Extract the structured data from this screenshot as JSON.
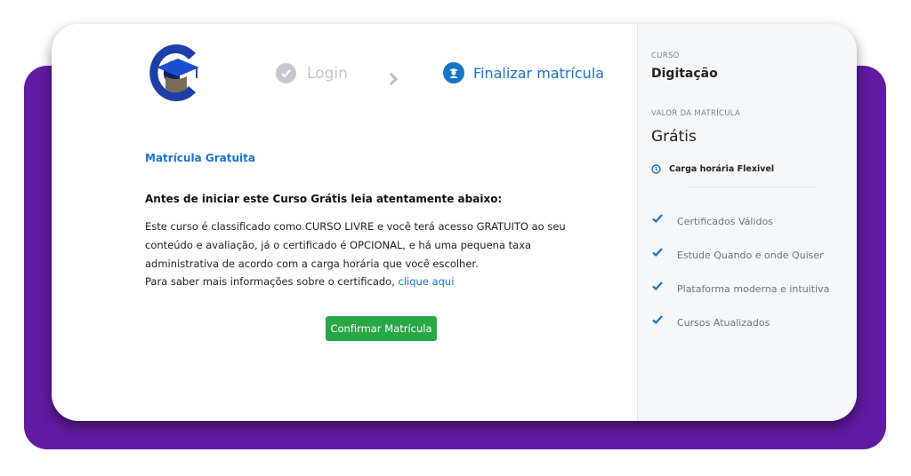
{
  "steps": {
    "login_label": "Login",
    "finalize_label": "Finalizar matrícula"
  },
  "main": {
    "section_title": "Matrícula Gratuita",
    "heading": "Antes de iniciar este Curso Grátis leia atentamente abaixo:",
    "body": "Este curso é classificado como CURSO LIVRE e você terá acesso GRATUITO ao seu conteúdo e avaliação, já o certificado é OPCIONAL, e há uma pequena taxa administrativa de acordo com a carga horária que você escolher.",
    "info_text": "Para saber mais informações sobre o certificado,",
    "info_link": "clique aqui",
    "confirm_label": "Confirmar Matrícula"
  },
  "sidebar": {
    "course_label": "CURSO",
    "course_name": "Digitação",
    "price_label": "VALOR DA MATRÍCULA",
    "price": "Grátis",
    "hours": "Carga horária Flexivel",
    "features": [
      "Certificados Válidos",
      "Estude Quando e onde Quiser",
      "Plataforma moderna e intuitiva",
      "Cursos Atualizados"
    ]
  },
  "colors": {
    "accent": "#1a73c9",
    "confirm": "#28a745",
    "backdrop": "#611aa1"
  }
}
